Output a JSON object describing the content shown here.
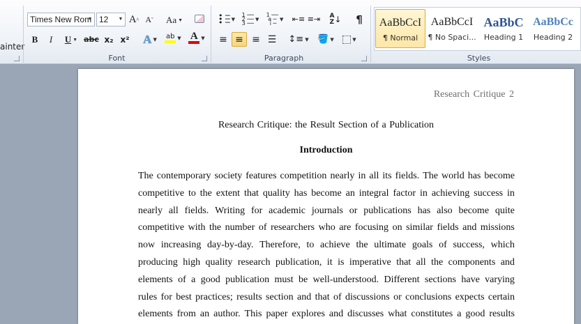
{
  "ribbon": {
    "clipboard": {
      "painter_label": "ainter"
    },
    "font": {
      "group_label": "Font",
      "font_name": "Times New Rom",
      "font_size": "12",
      "grow_label": "A",
      "shrink_label": "A",
      "change_case_label": "Aa",
      "bold_label": "B",
      "italic_label": "I",
      "underline_label": "U",
      "strike_label": "abc",
      "subscript_label": "x₂",
      "superscript_label": "x²",
      "highlight_label": "ab",
      "font_color_label": "A",
      "highlight_color": "#ffff00",
      "font_color": "#e00000"
    },
    "paragraph": {
      "group_label": "Paragraph",
      "pilcrow_label": "¶"
    },
    "styles": {
      "group_label": "Styles",
      "items": [
        {
          "preview": "AaBbCcI",
          "name": "¶ Normal",
          "selected": true
        },
        {
          "preview": "AaBbCcI",
          "name": "¶ No Spaci..."
        },
        {
          "preview": "AaBbC",
          "name": "Heading 1"
        },
        {
          "preview": "AaBbCc",
          "name": "Heading 2"
        }
      ]
    }
  },
  "document": {
    "header": "Research Critique 2",
    "title": "Research Critique: the Result Section of a Publication",
    "heading": "Introduction",
    "body_lines": [
      "The contemporary society features competition nearly in all its fields. The world has become",
      "competitive to the extent that quality has become an integral factor in achieving success in",
      "nearly all fields. Writing for academic journals or publications has also become quite",
      "competitive with the number of researchers who are focusing on similar fields and missions",
      "now increasing day-by-day. Therefore, to achieve the ultimate goals of success, which",
      "producing high quality research publication, it is imperative that all the components and",
      "elements of a good publication must be well-understood. Different sections have varying",
      "rules for best practices; results section and that of discussions or conclusions expects certain",
      "elements from an author. This paper explores and discusses what constitutes a good results"
    ]
  }
}
